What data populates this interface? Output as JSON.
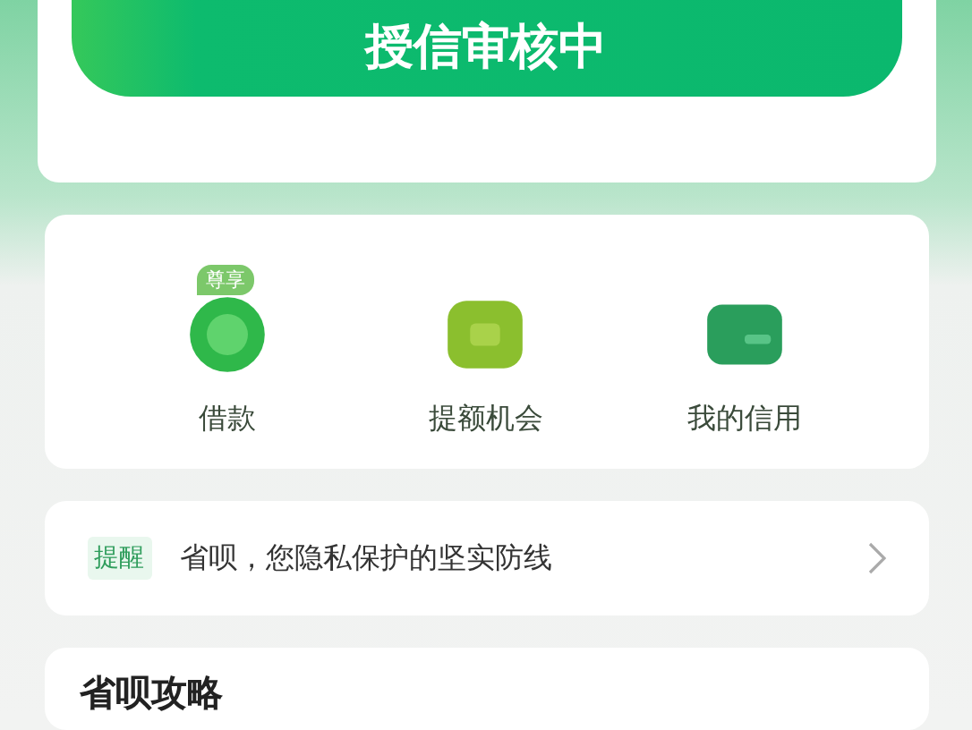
{
  "status_button": {
    "label": "授信审核中"
  },
  "shortcuts": [
    {
      "kind": "loan",
      "label": "借款",
      "badge": "尊享"
    },
    {
      "kind": "boost",
      "label": "提额机会"
    },
    {
      "kind": "credit",
      "label": "我的信用"
    }
  ],
  "notice": {
    "tag": "提醒",
    "text": "省呗，您隐私保护的坚实防线"
  },
  "section": {
    "title": "省呗攻略"
  }
}
